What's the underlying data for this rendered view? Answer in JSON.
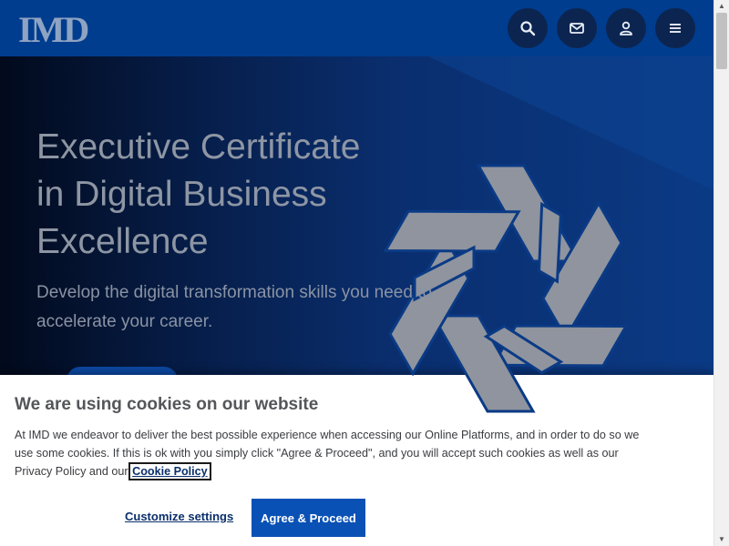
{
  "header": {
    "logo_text": "IMD",
    "buttons": [
      {
        "name": "search",
        "icon": "search-icon"
      },
      {
        "name": "contact",
        "icon": "mail-icon"
      },
      {
        "name": "account",
        "icon": "user-icon"
      },
      {
        "name": "menu",
        "icon": "hamburger-menu-icon"
      }
    ]
  },
  "hero": {
    "title_lines": [
      "Executive Certificate",
      "in Digital Business",
      "Excellence"
    ],
    "subtitle_lines": [
      "Develop the digital transformation skills you need to",
      "accelerate your career."
    ]
  },
  "cookie_banner": {
    "title": "We are using cookies on our website",
    "text_lines": [
      "At IMD we endeavor to deliver the best possible experience when accessing our Online Platforms, and in order to do so we",
      "use some cookies. If this is ok with you simply click \"Agree & Proceed\", and you will accept such cookies as well as our",
      "Privacy Policy and our"
    ],
    "policy_link": "Cookie Policy",
    "period": ".",
    "customize_label": "Customize settings",
    "agree_label": "Agree & Proceed"
  },
  "colors": {
    "header_bg": "#003d8f",
    "accent": "#0a51b5",
    "emblem": "#8f949e"
  }
}
